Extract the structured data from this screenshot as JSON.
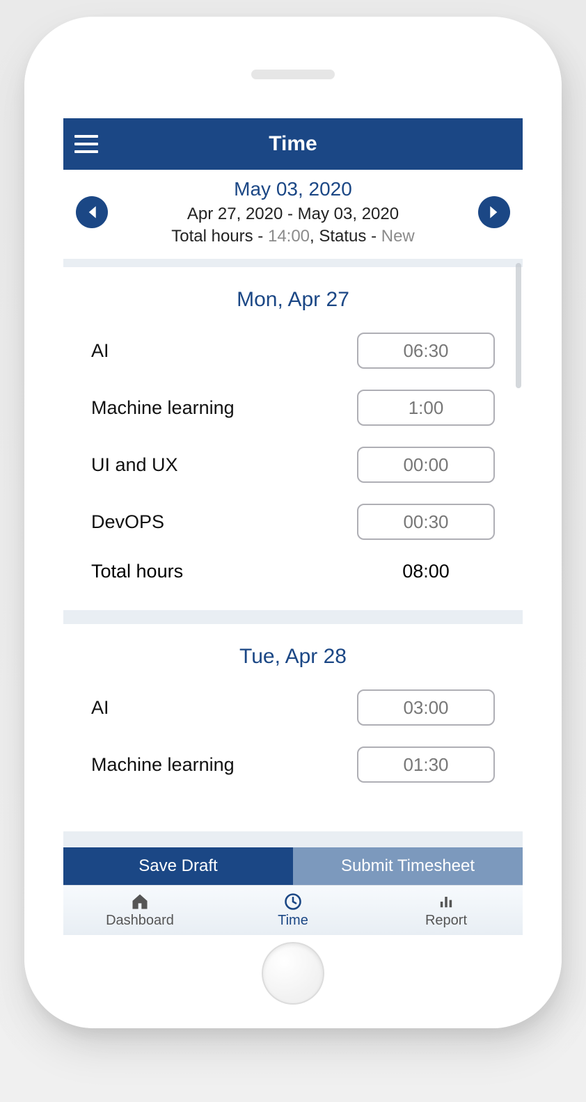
{
  "appbar": {
    "title": "Time"
  },
  "dateNav": {
    "mainDate": "May 03, 2020",
    "range": "Apr 27, 2020 - May 03, 2020",
    "totalLabel": "Total hours - ",
    "totalValue": "14:00",
    "statusLabel": ", Status - ",
    "statusValue": "New"
  },
  "days": [
    {
      "header": "Mon, Apr 27",
      "entries": [
        {
          "label": "AI",
          "value": "06:30"
        },
        {
          "label": "Machine learning",
          "value": "1:00"
        },
        {
          "label": "UI and UX",
          "value": "00:00"
        },
        {
          "label": "DevOPS",
          "value": "00:30"
        }
      ],
      "totalLabel": "Total hours",
      "totalValue": "08:00"
    },
    {
      "header": "Tue, Apr 28",
      "entries": [
        {
          "label": "AI",
          "value": "03:00"
        },
        {
          "label": "Machine learning",
          "value": "01:30"
        }
      ]
    }
  ],
  "actions": {
    "saveDraft": "Save Draft",
    "submit": "Submit Timesheet"
  },
  "tabs": {
    "dashboard": "Dashboard",
    "time": "Time",
    "report": "Report"
  }
}
